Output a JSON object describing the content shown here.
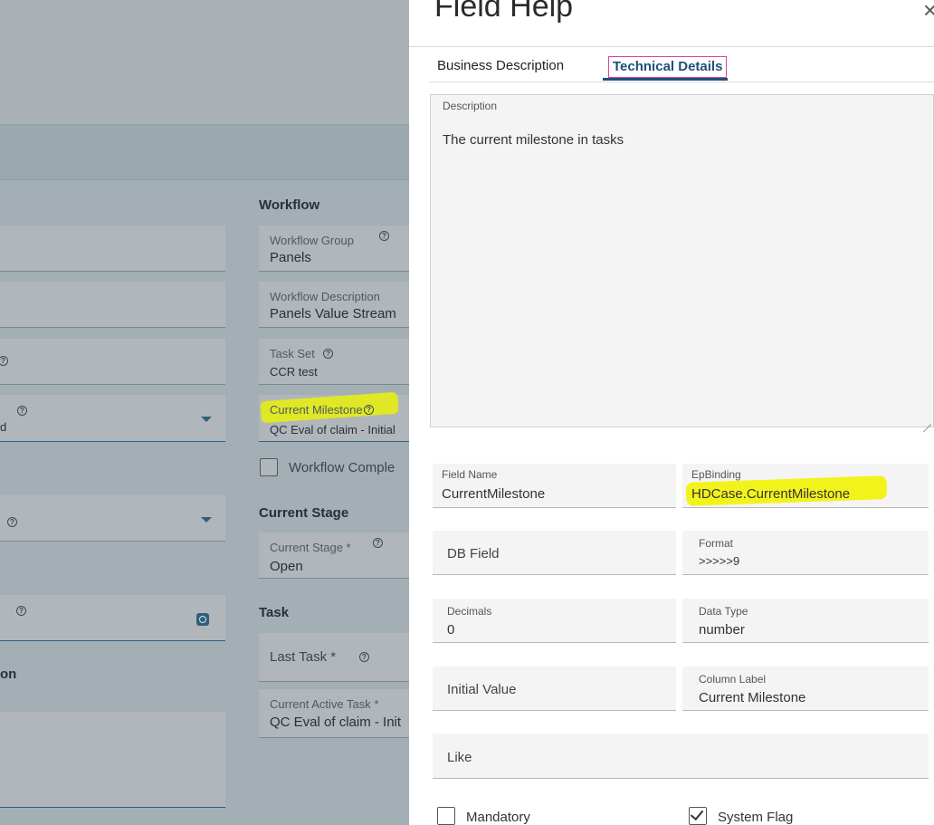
{
  "background_form": {
    "workflow_section_title": "Workflow",
    "workflow_group": {
      "label": "Workflow Group",
      "value": "Panels"
    },
    "workflow_description": {
      "label": "Workflow Description",
      "value": "Panels Value Stream"
    },
    "task_set": {
      "label": "Task Set",
      "value": "CCR test"
    },
    "current_milestone": {
      "label": "Current Milestone",
      "value": "QC Eval of claim - Initial"
    },
    "workflow_complete_label": "Workflow Comple",
    "current_stage_section_title": "Current Stage",
    "current_stage": {
      "label": "Current Stage *",
      "value": "Open"
    },
    "task_section_title": "Task",
    "last_task": {
      "label": "Last Task *"
    },
    "current_active_task": {
      "label": "Current Active Task *",
      "value": "QC Eval of claim - Init"
    },
    "left_partial_value": "d",
    "left_partial_section": "on",
    "help_glyph": "?"
  },
  "panel": {
    "title": "Field Help",
    "close_glyph": "×",
    "tabs": [
      {
        "label": "Business Description",
        "active": false
      },
      {
        "label": "Technical Details",
        "active": true
      }
    ],
    "description": {
      "label": "Description",
      "value": "The current milestone in tasks"
    },
    "fields": {
      "field_name": {
        "label": "Field Name",
        "value": "CurrentMilestone"
      },
      "ep_binding": {
        "label": "EpBinding",
        "value": "HDCase.CurrentMilestone"
      },
      "db_field": {
        "placeholder": "DB Field"
      },
      "format": {
        "label": "Format",
        "value": ">>>>>9"
      },
      "decimals": {
        "label": "Decimals",
        "value": "0"
      },
      "data_type": {
        "label": "Data Type",
        "value": "number"
      },
      "initial_value": {
        "placeholder": "Initial Value"
      },
      "column_label": {
        "label": "Column Label",
        "value": "Current Milestone"
      },
      "like": {
        "placeholder": "Like"
      }
    },
    "checkboxes": {
      "mandatory": {
        "label": "Mandatory",
        "checked": false
      },
      "system_flag": {
        "label": "System Flag",
        "checked": true
      }
    }
  },
  "colors": {
    "accent": "#1f4f7a",
    "highlight": "#f3f31c",
    "overlay": "#a3aeb5"
  }
}
